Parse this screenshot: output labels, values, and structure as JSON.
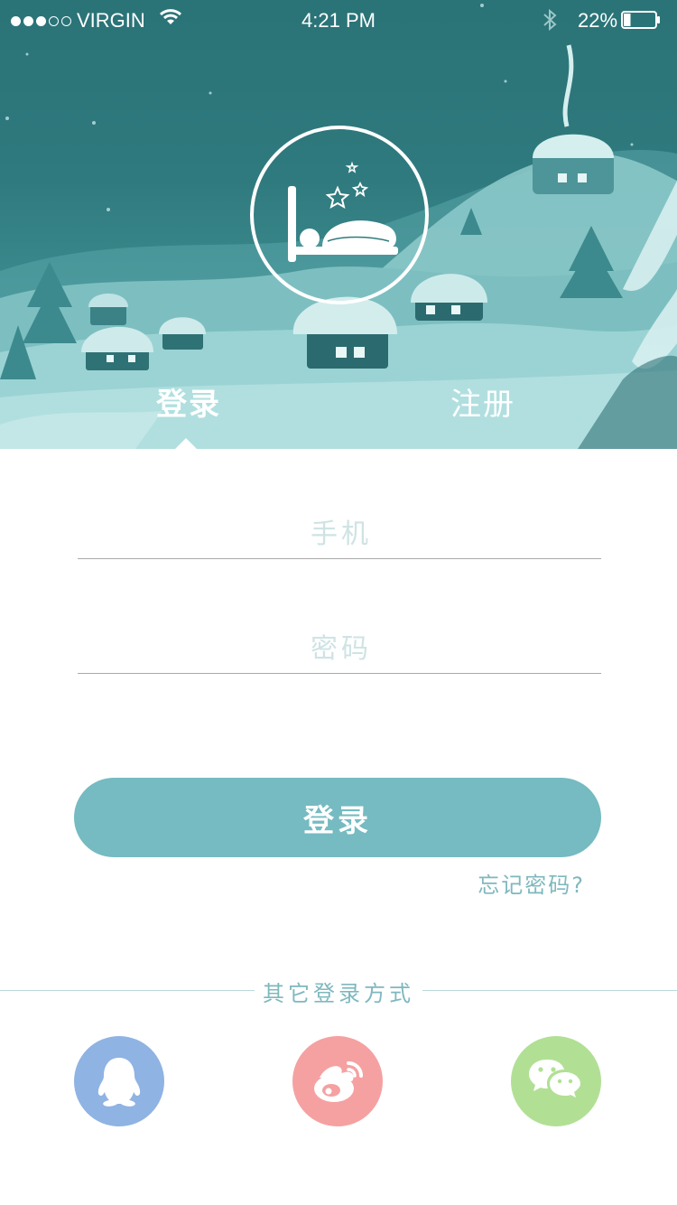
{
  "status_bar": {
    "carrier": "VIRGIN",
    "time": "4:21 PM",
    "battery": "22%",
    "battery_level": 0.22,
    "signal_bars": 3,
    "signal_total": 5
  },
  "logo": {
    "icon": "sleeping-bed-icon"
  },
  "tabs": [
    {
      "label": "登录",
      "active": true
    },
    {
      "label": "注册",
      "active": false
    }
  ],
  "form": {
    "phone_placeholder": "手机",
    "password_placeholder": "密码",
    "phone_value": "",
    "password_value": "",
    "login_button": "登录",
    "forgot_password": "忘记密码?"
  },
  "other_login": {
    "label": "其它登录方式",
    "providers": [
      {
        "icon": "qq-icon",
        "color": "#8fb3e3"
      },
      {
        "icon": "weibo-icon",
        "color": "#f5a1a1"
      },
      {
        "icon": "wechat-icon",
        "color": "#b1e095"
      }
    ]
  },
  "colors": {
    "accent": "#75bbc1",
    "hero_bg": "#2f7a7e",
    "link": "#7fb8be"
  }
}
